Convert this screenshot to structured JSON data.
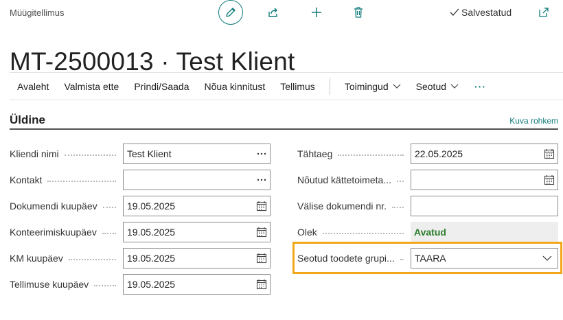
{
  "page_type": "Müügitellimus",
  "title": "MT-2500013 · Test Klient",
  "status_saved": "Salvestatud",
  "icons": {
    "edit": "pencil-icon",
    "share": "share-icon",
    "new": "plus-icon",
    "delete": "trash-icon",
    "saved": "check-icon",
    "open_new_window": "open-new-window-icon"
  },
  "actions": [
    "Avaleht",
    "Valmista ette",
    "Prindi/Saada",
    "Nõua kinnitust",
    "Tellimus"
  ],
  "menus": [
    "Toimingud",
    "Seotud"
  ],
  "more": "···",
  "section": {
    "title": "Üldine",
    "show_more": "Kuva rohkem"
  },
  "left_fields": [
    {
      "label": "Kliendi nimi",
      "value": "Test Klient",
      "trail": "lookup"
    },
    {
      "label": "Kontakt",
      "value": "",
      "trail": "lookup"
    },
    {
      "label": "Dokumendi kuupäev",
      "value": "19.05.2025",
      "trail": "calendar"
    },
    {
      "label": "Konteerimiskuupäev",
      "value": "19.05.2025",
      "trail": "calendar"
    },
    {
      "label": "KM kuupäev",
      "value": "19.05.2025",
      "trail": "calendar"
    },
    {
      "label": "Tellimuse kuupäev",
      "value": "19.05.2025",
      "trail": "calendar"
    }
  ],
  "right_fields": [
    {
      "label": "Tähtaeg",
      "value": "22.05.2025",
      "trail": "calendar"
    },
    {
      "label": "Nõutud kättetoimeta...",
      "value": "",
      "trail": "calendar"
    },
    {
      "label": "Välise dokumendi nr.",
      "value": "",
      "trail": "none"
    },
    {
      "label": "Olek",
      "value": "Avatud",
      "trail": "status"
    },
    {
      "label": "Seotud toodete grupi...",
      "value": "TAARA",
      "trail": "dropdown"
    }
  ],
  "colors": {
    "accent": "#0f7c7a",
    "status_open": "#2d7d2d",
    "highlight": "#f3a81c"
  }
}
